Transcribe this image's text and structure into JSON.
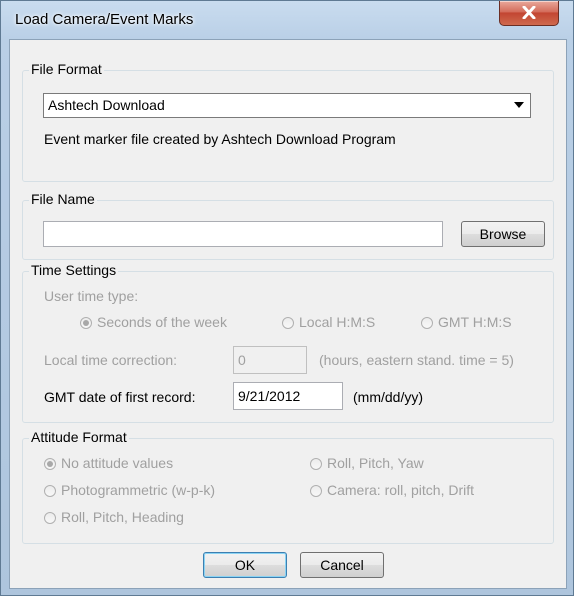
{
  "window": {
    "title": "Load Camera/Event Marks"
  },
  "file_format": {
    "legend": "File Format",
    "selected": "Ashtech Download",
    "description": "Event marker file created by Ashtech Download Program"
  },
  "file_name": {
    "legend": "File Name",
    "value": "",
    "browse_label": "Browse"
  },
  "time_settings": {
    "legend": "Time Settings",
    "user_time_type_label": "User time type:",
    "options": [
      {
        "label": "Seconds of the week",
        "checked": true
      },
      {
        "label": "Local H:M:S",
        "checked": false
      },
      {
        "label": "GMT H:M:S",
        "checked": false
      }
    ],
    "local_correction_label": "Local time correction:",
    "local_correction_value": "0",
    "local_correction_hint": "(hours, eastern stand. time = 5)",
    "gmt_date_label": "GMT date of first record:",
    "gmt_date_value": "9/21/2012",
    "gmt_date_hint": "(mm/dd/yy)"
  },
  "attitude_format": {
    "legend": "Attitude Format",
    "options": [
      {
        "label": "No attitude values",
        "checked": true
      },
      {
        "label": "Roll, Pitch, Yaw",
        "checked": false
      },
      {
        "label": "Photogrammetric (w-p-k)",
        "checked": false
      },
      {
        "label": "Camera: roll, pitch, Drift",
        "checked": false
      },
      {
        "label": "Roll, Pitch, Heading",
        "checked": false
      }
    ]
  },
  "buttons": {
    "ok": "OK",
    "cancel": "Cancel"
  },
  "colors": {
    "disabled_text": "#a0a0a0",
    "close_button": "#c24632"
  }
}
